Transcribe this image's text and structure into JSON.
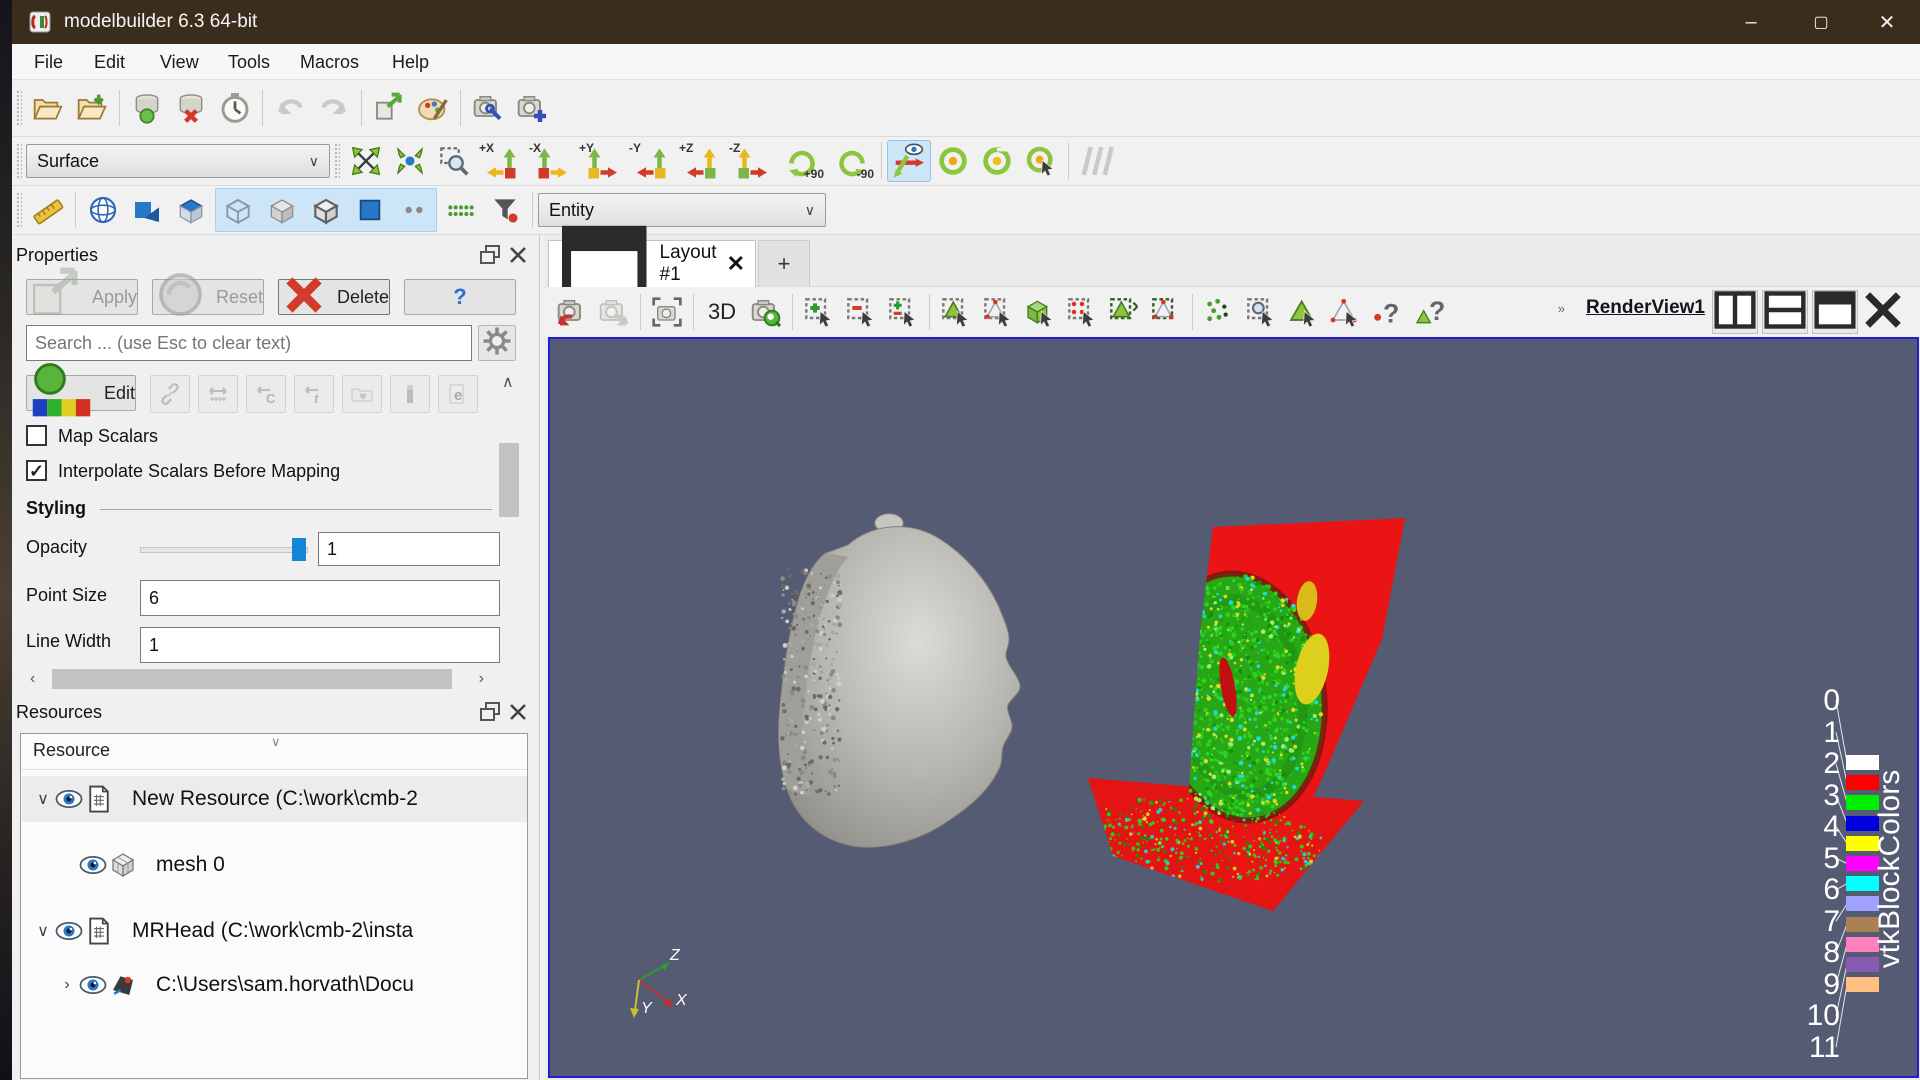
{
  "window": {
    "title": "modelbuilder 6.3 64-bit",
    "controls": {
      "minimize": "–",
      "maximize": "▢",
      "close": "✕"
    }
  },
  "menu": {
    "items": [
      "File",
      "Edit",
      "View",
      "Tools",
      "Macros",
      "Help"
    ]
  },
  "toolbars": {
    "main_icons": [
      "open-file",
      "import-resource",
      "sep",
      "create-source",
      "remove-source",
      "timer",
      "sep",
      "undo!",
      "redo!",
      "sep",
      "export-scene",
      "color-palette",
      "sep",
      "camera-wrench",
      "camera-add"
    ],
    "zoom_icons": [
      "zoom-to-fit",
      "zoom-closest",
      "zoom-to-box"
    ],
    "camera_views": [
      "+X",
      "-X",
      "+Y",
      "-Y",
      "+Z",
      "-Z"
    ],
    "rotations": [
      "+90",
      "-90"
    ],
    "rotate_icons": [
      "rotate-camera-cw",
      "rotate-camera-ccw",
      "rotate-camera-pointer"
    ],
    "representation": {
      "value": "Surface"
    },
    "entity": {
      "value": "Entity"
    },
    "row3_left_icons": [
      "measure-ruler",
      "sep",
      "mesh-representation",
      "surface-representation",
      "volume-representation"
    ],
    "row3_highlight_icons": [
      "cube-outline",
      "cube-shaded",
      "cube-edges",
      "blue-square",
      "dots-pair"
    ],
    "row3_right_icons": [
      "green-grid-dots",
      "selection-filter"
    ]
  },
  "properties_panel": {
    "title": "Properties",
    "buttons": {
      "apply": "Apply",
      "reset": "Reset",
      "delete": "Delete",
      "help": "?"
    },
    "search_placeholder": "Search ... (use Esc to clear text)",
    "edit_label": "Edit",
    "edit_icons": [
      "separate-colormap!",
      "rescale-data-range!",
      "rescale-custom-range!",
      "rescale-temporal-range!",
      "colormap-preset!",
      "show-color-legend!",
      "edit-color-legend!"
    ],
    "map_scalars": {
      "label": "Map Scalars",
      "checked": false
    },
    "interpolate": {
      "label": "Interpolate Scalars Before Mapping",
      "checked": true
    },
    "styling": {
      "heading": "Styling",
      "opacity": {
        "label": "Opacity",
        "value": "1"
      },
      "point_size": {
        "label": "Point Size",
        "value": "6"
      },
      "line_width": {
        "label": "Line Width",
        "value": "1"
      }
    }
  },
  "resources_panel": {
    "title": "Resources",
    "column": "Resource",
    "items": [
      {
        "label": "New Resource (C:\\work\\cmb-2"
      },
      {
        "label": "mesh 0"
      },
      {
        "label": "MRHead (C:\\work\\cmb-2\\insta"
      },
      {
        "label": "C:\\Users\\sam.horvath\\Docu"
      }
    ]
  },
  "layout": {
    "tab": "Layout #1",
    "tab_close": "✕",
    "new_tab": "+",
    "view_mode": "3D",
    "view_label": "RenderView1",
    "view_chevron": "»"
  },
  "render_toolbar": {
    "left_icons": [
      "camera-reset",
      "camera-redo!"
    ],
    "capture_icons": [
      "capture-screenshot"
    ],
    "select_icons": [
      "camera-zoom-data",
      "sep",
      "select-cells-on",
      "select-points-on",
      "select-cells-add",
      "sep",
      "select-cells-through",
      "select-points-through",
      "select-block",
      "select-block-points",
      "interactive-select-cells",
      "interactive-select-points",
      "sep",
      "grow-selection",
      "zoom-to-selection",
      "hover-cells",
      "hover-points",
      "selection-query",
      "selection-query-cells"
    ]
  },
  "render_view": {
    "background": "#555b72",
    "axes": {
      "x": {
        "label": "X",
        "color": "#c03030"
      },
      "y": {
        "label": "Y",
        "color": "#c8c232"
      },
      "z": {
        "label": "Z",
        "color": "#2f9a30"
      }
    },
    "legend": {
      "title": "vtkBlockColors",
      "entries": [
        {
          "index": "0",
          "color": "#ffffff"
        },
        {
          "index": "1",
          "color": "#ff0000"
        },
        {
          "index": "2",
          "color": "#00ee00"
        },
        {
          "index": "3",
          "color": "#0000dd"
        },
        {
          "index": "4",
          "color": "#ffff00"
        },
        {
          "index": "5",
          "color": "#ff00ff"
        },
        {
          "index": "6",
          "color": "#00ffff"
        },
        {
          "index": "7",
          "color": "#a1a1ff"
        },
        {
          "index": "8",
          "color": "#ab8054"
        },
        {
          "index": "9",
          "color": "#ff80bf"
        },
        {
          "index": "10",
          "color": "#875ab3"
        },
        {
          "index": "11",
          "color": "#ffbf80"
        }
      ]
    }
  }
}
